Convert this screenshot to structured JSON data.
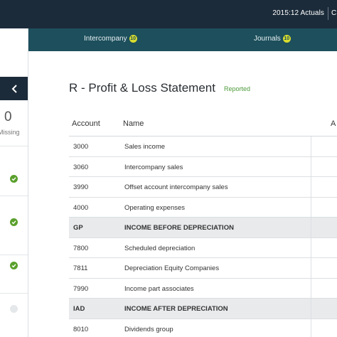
{
  "topbar": {
    "period": "2015:12 Actuals",
    "truncated": "C"
  },
  "tabs": [
    {
      "label": "Intercompany",
      "badge": "10"
    },
    {
      "label": "Journals",
      "badge": "10"
    }
  ],
  "left_panel": {
    "count": "0",
    "count_label": "Missing",
    "items": [
      {
        "status": "complete"
      },
      {
        "status": "complete"
      },
      {
        "status": "complete"
      },
      {
        "status": "pending"
      }
    ]
  },
  "report": {
    "title": "R - Profit & Loss Statement",
    "status": "Reported",
    "columns": {
      "account": "Account",
      "name": "Name",
      "amount_truncated": "A"
    },
    "rows": [
      {
        "account": "3000",
        "name": "Sales income",
        "highlight": false
      },
      {
        "account": "3060",
        "name": "Intercompany sales",
        "highlight": false
      },
      {
        "account": "3990",
        "name": "Offset account intercompany sales",
        "highlight": false
      },
      {
        "account": "4000",
        "name": "Operating expenses",
        "highlight": false
      },
      {
        "account": "GP",
        "name": "INCOME BEFORE DEPRECIATION",
        "highlight": true
      },
      {
        "account": "7800",
        "name": "Scheduled depreciation",
        "highlight": false
      },
      {
        "account": "7811",
        "name": "Depreciation Equity Companies",
        "highlight": false
      },
      {
        "account": "7990",
        "name": "Income part associates",
        "highlight": false
      },
      {
        "account": "IAD",
        "name": "INCOME AFTER DEPRECIATION",
        "highlight": true
      },
      {
        "account": "8010",
        "name": "Dividends group",
        "highlight": false
      }
    ]
  },
  "colors": {
    "nav_dark": "#1c2b3a",
    "tab_teal": "#1d4f5c",
    "badge": "#d8dc2e",
    "ok_green": "#5aa02c",
    "reported": "#4d9a3a"
  },
  "icons": {
    "collapse": "chevron-left-icon",
    "status_ok": "check-circle-icon",
    "status_pending": "empty-circle-icon"
  }
}
